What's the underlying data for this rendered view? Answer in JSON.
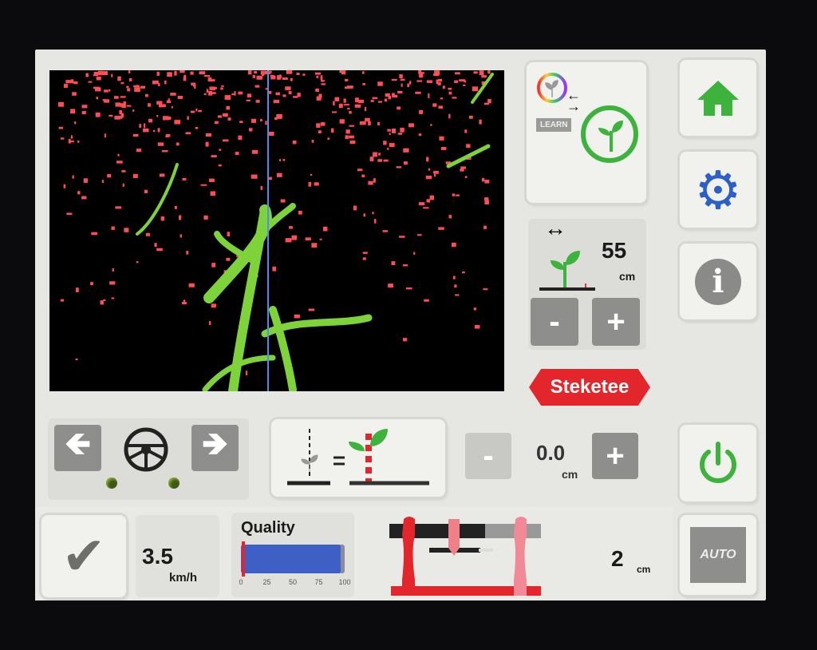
{
  "learn": {
    "badge": "LEARN"
  },
  "row_spacing": {
    "value": "55",
    "unit": "cm",
    "minus": "-",
    "plus": "+"
  },
  "brand": {
    "logo": "Steketee"
  },
  "offset": {
    "value": "0.0",
    "unit": "cm",
    "minus": "-",
    "plus": "+"
  },
  "speed": {
    "value": "3.5",
    "unit": "km/h"
  },
  "quality": {
    "label": "Quality",
    "ticks": [
      "0",
      "25",
      "50",
      "75",
      "100"
    ],
    "level_percent": 96,
    "threshold_percent": 1
  },
  "hitch": {
    "value": "2",
    "unit": "cm"
  },
  "auto_button": {
    "label": "AUTO"
  },
  "colors": {
    "crop": "#7ed23a",
    "weed": "#ff4d55",
    "guide_line": "#4a8ff0",
    "accent_green": "#3db33d",
    "gear_blue": "#2d5fc8",
    "brand_red": "#e3262b",
    "bar_blue": "#3e5fc4"
  },
  "icons": [
    "home-icon",
    "gear-icon",
    "info-icon",
    "power-icon",
    "check-icon",
    "steering-wheel-icon",
    "arrow-left-icon",
    "arrow-right-icon",
    "plant-icon"
  ]
}
